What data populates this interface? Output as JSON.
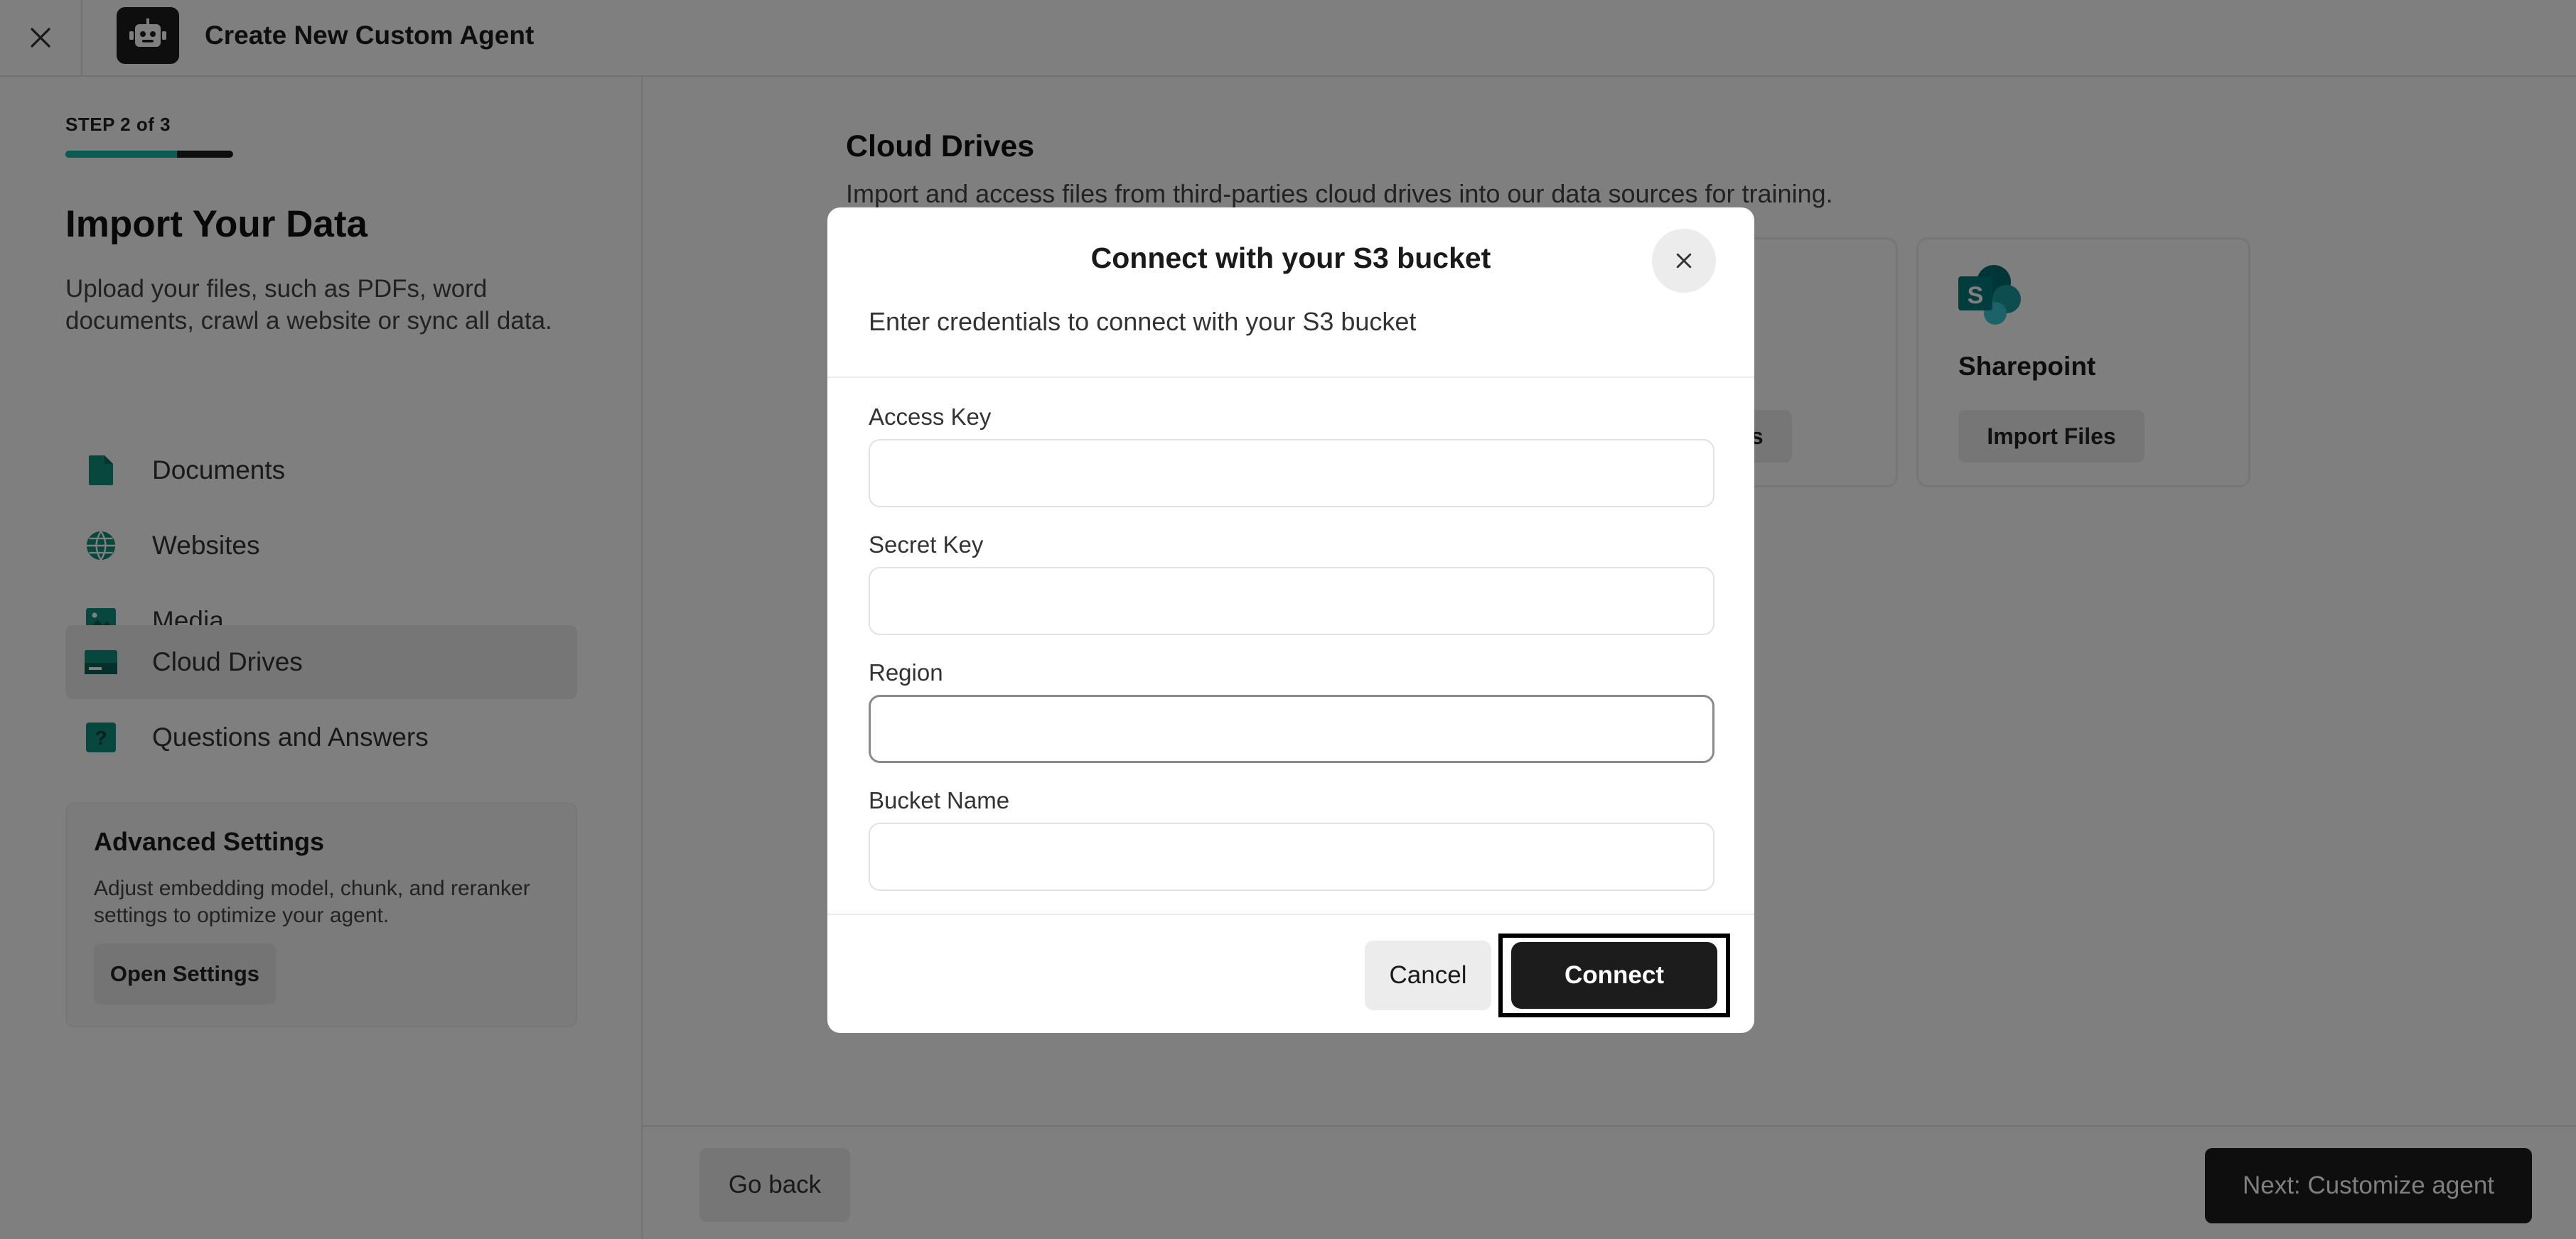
{
  "header": {
    "title": "Create New Custom Agent"
  },
  "sidebar": {
    "step_label": "STEP 2 of 3",
    "progress_fraction": 0.667,
    "heading": "Import Your Data",
    "description": "Upload your files, such as PDFs, word documents, crawl a website or sync all data.",
    "nav": [
      {
        "label": "Documents",
        "icon": "document-icon",
        "active": false
      },
      {
        "label": "Websites",
        "icon": "globe-icon",
        "active": false
      },
      {
        "label": "Media",
        "icon": "image-icon",
        "active": false
      },
      {
        "label": "Cloud Drives",
        "icon": "drive-icon",
        "active": true
      },
      {
        "label": "Questions and Answers",
        "icon": "question-icon",
        "active": false
      }
    ],
    "advanced": {
      "title": "Advanced Settings",
      "description": "Adjust embedding model, chunk, and reranker settings to optimize your agent.",
      "button": "Open Settings"
    }
  },
  "main": {
    "title": "Cloud Drives",
    "description": "Import and access files from third-parties cloud drives into our data sources for training.",
    "drives": [
      {
        "name": "",
        "button": "Import Files"
      },
      {
        "name": "Sharepoint",
        "button": "Import Files",
        "icon": "sharepoint-icon"
      }
    ]
  },
  "footer": {
    "back": "Go back",
    "next": "Next: Customize agent"
  },
  "modal": {
    "title": "Connect with your S3 bucket",
    "subtitle": "Enter credentials to connect with your S3 bucket",
    "fields": [
      {
        "label": "Access Key",
        "value": "",
        "placeholder": ""
      },
      {
        "label": "Secret Key",
        "value": "",
        "placeholder": ""
      },
      {
        "label": "Region",
        "value": "",
        "placeholder": ""
      },
      {
        "label": "Bucket Name",
        "value": "",
        "placeholder": ""
      }
    ],
    "cancel": "Cancel",
    "connect": "Connect"
  },
  "colors": {
    "accent": "#14b8a6",
    "dark": "#1c1c1c",
    "sharepoint": "#0f7b7b"
  }
}
